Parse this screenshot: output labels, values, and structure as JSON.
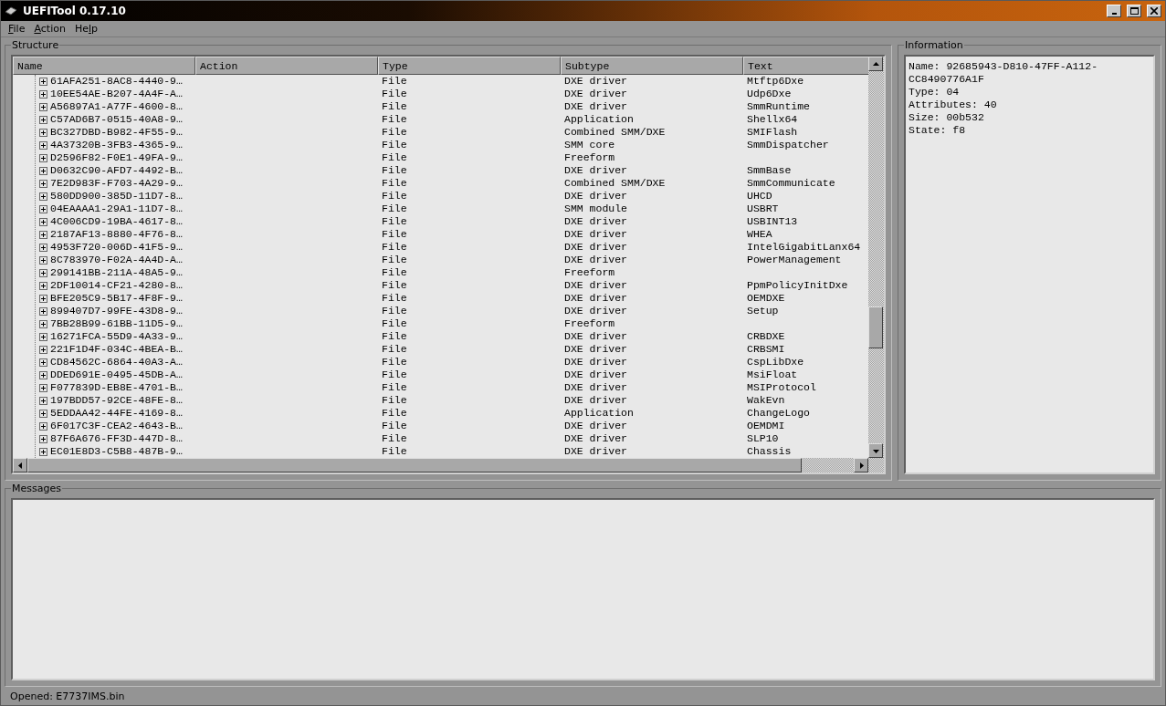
{
  "window": {
    "title": "UEFITool 0.17.10"
  },
  "menu": [
    {
      "accel": "F",
      "after": "ile"
    },
    {
      "accel": "A",
      "after": "ction"
    },
    {
      "before": "He",
      "accel": "l",
      "after": "p"
    }
  ],
  "structure": {
    "title": "Structure",
    "columns": [
      "Name",
      "Action",
      "Type",
      "Subtype",
      "Text"
    ],
    "rows": [
      {
        "name": "61AFA251-8AC8-4440-9…",
        "type": "File",
        "subtype": "DXE driver",
        "text": "Mtftp6Dxe",
        "expanded": false
      },
      {
        "name": "10EE54AE-B207-4A4F-A…",
        "type": "File",
        "subtype": "DXE driver",
        "text": "Udp6Dxe",
        "expanded": false
      },
      {
        "name": "A56897A1-A77F-4600-8…",
        "type": "File",
        "subtype": "DXE driver",
        "text": "SmmRuntime",
        "expanded": false
      },
      {
        "name": "C57AD6B7-0515-40A8-9…",
        "type": "File",
        "subtype": "Application",
        "text": "Shellx64",
        "expanded": false
      },
      {
        "name": "BC327DBD-B982-4F55-9…",
        "type": "File",
        "subtype": "Combined SMM/DXE",
        "text": "SMIFlash",
        "expanded": false
      },
      {
        "name": "4A37320B-3FB3-4365-9…",
        "type": "File",
        "subtype": "SMM core",
        "text": "SmmDispatcher",
        "expanded": false
      },
      {
        "name": "D2596F82-F0E1-49FA-9…",
        "type": "File",
        "subtype": "Freeform",
        "expanded": false
      },
      {
        "name": "D0632C90-AFD7-4492-B…",
        "type": "File",
        "subtype": "DXE driver",
        "text": "SmmBase",
        "expanded": false
      },
      {
        "name": "7E2D983F-F703-4A29-9…",
        "type": "File",
        "subtype": "Combined SMM/DXE",
        "text": "SmmCommunicate",
        "expanded": false
      },
      {
        "name": "580DD900-385D-11D7-8…",
        "type": "File",
        "subtype": "DXE driver",
        "text": "UHCD",
        "expanded": false
      },
      {
        "name": "04EAAAA1-29A1-11D7-8…",
        "type": "File",
        "subtype": "SMM module",
        "text": "USBRT",
        "expanded": false
      },
      {
        "name": "4C006CD9-19BA-4617-8…",
        "type": "File",
        "subtype": "DXE driver",
        "text": "USBINT13",
        "expanded": false
      },
      {
        "name": "2187AF13-8880-4F76-8…",
        "type": "File",
        "subtype": "DXE driver",
        "text": "WHEA",
        "expanded": false
      },
      {
        "name": "4953F720-006D-41F5-9…",
        "type": "File",
        "subtype": "DXE driver",
        "text": "IntelGigabitLanx64",
        "expanded": false
      },
      {
        "name": "8C783970-F02A-4A4D-A…",
        "type": "File",
        "subtype": "DXE driver",
        "text": "PowerManagement",
        "expanded": false
      },
      {
        "name": "299141BB-211A-48A5-9…",
        "type": "File",
        "subtype": "Freeform",
        "expanded": false
      },
      {
        "name": "2DF10014-CF21-4280-8…",
        "type": "File",
        "subtype": "DXE driver",
        "text": "PpmPolicyInitDxe",
        "expanded": false
      },
      {
        "name": "BFE205C9-5B17-4F8F-9…",
        "type": "File",
        "subtype": "DXE driver",
        "text": "OEMDXE",
        "expanded": false
      },
      {
        "name": "899407D7-99FE-43D8-9…",
        "type": "File",
        "subtype": "DXE driver",
        "text": "Setup",
        "expanded": false
      },
      {
        "name": "7BB28B99-61BB-11D5-9…",
        "type": "File",
        "subtype": "Freeform",
        "expanded": false
      },
      {
        "name": "16271FCA-55D9-4A33-9…",
        "type": "File",
        "subtype": "DXE driver",
        "text": "CRBDXE",
        "expanded": false
      },
      {
        "name": "221F1D4F-034C-4BEA-B…",
        "type": "File",
        "subtype": "DXE driver",
        "text": "CRBSMI",
        "expanded": false
      },
      {
        "name": "CD84562C-6864-40A3-A…",
        "type": "File",
        "subtype": "DXE driver",
        "text": "CspLibDxe",
        "expanded": false
      },
      {
        "name": "DDED691E-0495-45DB-A…",
        "type": "File",
        "subtype": "DXE driver",
        "text": "MsiFloat",
        "expanded": false
      },
      {
        "name": "F077839D-EB8E-4701-B…",
        "type": "File",
        "subtype": "DXE driver",
        "text": "MSIProtocol",
        "expanded": false
      },
      {
        "name": "197BDD57-92CE-48FE-8…",
        "type": "File",
        "subtype": "DXE driver",
        "text": "WakEvn",
        "expanded": false
      },
      {
        "name": "5EDDAA42-44FE-4169-8…",
        "type": "File",
        "subtype": "Application",
        "text": "ChangeLogo",
        "expanded": false
      },
      {
        "name": "6F017C3F-CEA2-4643-B…",
        "type": "File",
        "subtype": "DXE driver",
        "text": "OEMDMI",
        "expanded": false
      },
      {
        "name": "87F6A676-FF3D-447D-8…",
        "type": "File",
        "subtype": "DXE driver",
        "text": "SLP10",
        "expanded": false
      },
      {
        "name": "EC01E8D3-C5B8-487B-9…",
        "type": "File",
        "subtype": "DXE driver",
        "text": "Chassis",
        "expanded": false
      }
    ]
  },
  "information": {
    "title": "Information",
    "lines": [
      "Name: 92685943-D810-47FF-A112-",
      "CC8490776A1F",
      "Type: 04",
      "Attributes: 40",
      "Size: 00b532",
      "State: f8"
    ]
  },
  "messages": {
    "title": "Messages"
  },
  "status_bar": "Opened: E7737IMS.bin"
}
